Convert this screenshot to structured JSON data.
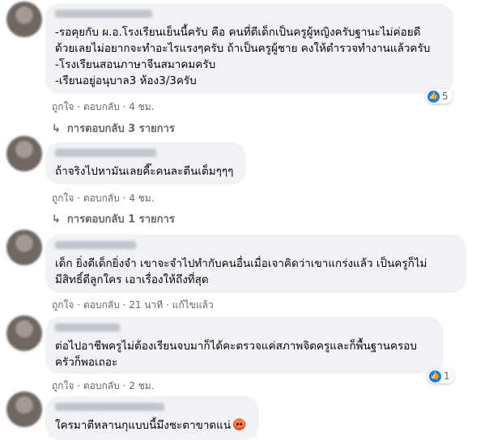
{
  "comments": [
    {
      "lines": [
        "-รอคุยกับ ผ.อ.โรงเรียนเย็นนี้ครับ คือ คนที่ตีเด็กเป็นครูผู้หญิงครับฐานะไม่ค่อยดี",
        "ด้วยเลยไม่อยากจะทำอะไรแรงๆครับ ถ้าเป็นครูผู้ชาย คงให้ตำรวจทำงานแล้วครับ",
        "-โรงเรียนสอนภาษาจีนสมาคมครับ",
        "-เรียนอยู่อนุบาล3 ห้อง3/3ครับ"
      ],
      "like": "ถูกใจ",
      "reply": "ตอบกลับ",
      "time": "4 ชม.",
      "reaction_count": "5",
      "replies_text": "การตอบกลับ 3 รายการ"
    },
    {
      "lines": [
        "ถ้าจริงไปหามันเลยคี๊ะคนละตีนเต็มๆๆๆ"
      ],
      "like": "ถูกใจ",
      "reply": "ตอบกลับ",
      "time": "4 ชม.",
      "replies_text": "การตอบกลับ 1 รายการ"
    },
    {
      "lines": [
        "เด็ก ยิ่งตีเด็กยิ่งจำ เขาจะจำไปทำกับคนอื่นเมื่อเจาคิดว่าเขาแกร่งแล้ว เป็นครูก็ไม่",
        "มีสิทธิ์ตีลูกใคร เอาเรื่องให้ถึงที่สุด"
      ],
      "like": "ถูกใจ",
      "reply": "ตอบกลับ",
      "time": "21 นาที",
      "edited": "แก้ไขแล้ว"
    },
    {
      "lines": [
        "ต่อไปอาชีพครูไม่ต้องเรียนจบมาก็ได้คะตรวจแค่สภาพจิตครูและก็พื้นฐานครอบ",
        "ครัวก็พอเถอะ"
      ],
      "like": "ถูกใจ",
      "reply": "ตอบกลับ",
      "time": "2 ชม.",
      "reaction_count": "1"
    },
    {
      "lines": [
        "ใครมาตีหลานกุแบบนี้มึงชะตาขาดแน่"
      ]
    }
  ],
  "icons": {
    "like": "thumbs-up-icon",
    "angry": "angry-emoji-icon",
    "reply_arrow": "reply-arrow-icon"
  },
  "colors": {
    "bubble": "#f0f2f5",
    "meta": "#65676b",
    "like_blue": "#2078f4"
  }
}
